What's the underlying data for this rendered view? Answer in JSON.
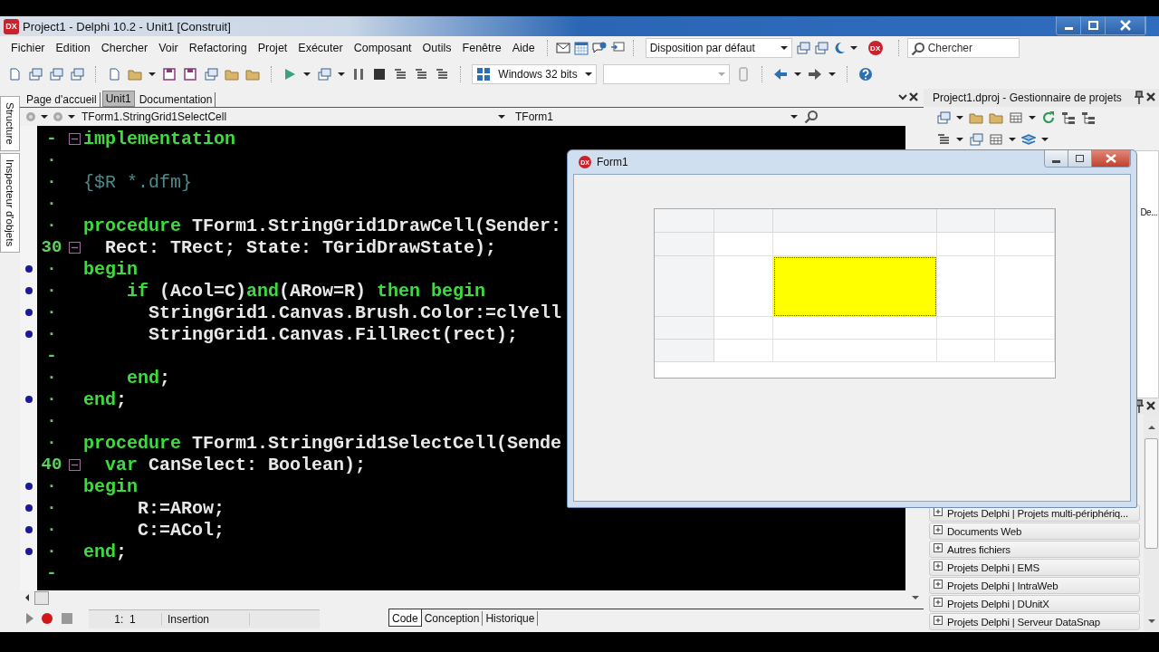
{
  "window": {
    "logo": "DX",
    "title": "Project1 - Delphi 10.2 - Unit1 [Construit]"
  },
  "menu": [
    "Fichier",
    "Edition",
    "Chercher",
    "Voir",
    "Refactoring",
    "Projet",
    "Exécuter",
    "Composant",
    "Outils",
    "Fenêtre",
    "Aide"
  ],
  "layout_combo": {
    "value": "Disposition par défaut"
  },
  "toolbar_logo": "DX",
  "search": {
    "placeholder": "Chercher"
  },
  "platform_combo": {
    "value": "Windows 32 bits"
  },
  "side_tabs": [
    "Structure",
    "Inspecteur d'objets"
  ],
  "editor_tabs": [
    {
      "label": "Page d'accueil",
      "selected": false
    },
    {
      "label": "Unit1",
      "selected": true
    },
    {
      "label": "Documentation",
      "selected": false
    }
  ],
  "method_combo": {
    "value": "TForm1.StringGrid1SelectCell"
  },
  "class_combo": {
    "value": "TForm1"
  },
  "code_lines": [
    {
      "gutter": "-",
      "breakpoint": false,
      "fold": true,
      "tokens": [
        {
          "kind": "keyword",
          "text": "implementation"
        }
      ]
    },
    {
      "gutter": "·",
      "breakpoint": false,
      "fold": false
    },
    {
      "gutter": "·",
      "breakpoint": false,
      "fold": false,
      "tokens": [
        {
          "kind": "comment",
          "text": "{$R *.dfm}"
        }
      ]
    },
    {
      "gutter": "·",
      "breakpoint": false,
      "fold": false
    },
    {
      "gutter": "·",
      "breakpoint": false,
      "fold": false,
      "tokens": [
        {
          "kind": "keyword",
          "text": "procedure"
        },
        {
          "kind": "plain",
          "text": " TForm1.StringGrid1DrawCell(Sender:"
        }
      ]
    },
    {
      "gutter": "30",
      "breakpoint": false,
      "fold": true,
      "tokens": [
        {
          "kind": "plain",
          "text": "  Rect: TRect; State: TGridDrawState);"
        }
      ]
    },
    {
      "gutter": "·",
      "breakpoint": true,
      "fold": false,
      "tokens": [
        {
          "kind": "keyword",
          "text": "begin"
        }
      ]
    },
    {
      "gutter": "·",
      "breakpoint": true,
      "fold": false,
      "tokens": [
        {
          "kind": "keyword",
          "text": "    if"
        },
        {
          "kind": "plain",
          "text": " (Acol=C)"
        },
        {
          "kind": "keyword",
          "text": "and"
        },
        {
          "kind": "plain",
          "text": "(ARow=R) "
        },
        {
          "kind": "keyword",
          "text": "then begin"
        }
      ]
    },
    {
      "gutter": "·",
      "breakpoint": true,
      "fold": false,
      "tokens": [
        {
          "kind": "plain",
          "text": "      StringGrid1.Canvas.Brush.Color:=clYell"
        }
      ]
    },
    {
      "gutter": "·",
      "breakpoint": true,
      "fold": false,
      "tokens": [
        {
          "kind": "plain",
          "text": "      StringGrid1.Canvas.FillRect(rect);"
        }
      ]
    },
    {
      "gutter": "-",
      "breakpoint": false,
      "fold": false
    },
    {
      "gutter": "·",
      "breakpoint": false,
      "fold": false,
      "tokens": [
        {
          "kind": "keyword",
          "text": "    end"
        },
        {
          "kind": "plain",
          "text": ";"
        }
      ]
    },
    {
      "gutter": "·",
      "breakpoint": true,
      "fold": false,
      "tokens": [
        {
          "kind": "keyword",
          "text": "end"
        },
        {
          "kind": "plain",
          "text": ";"
        }
      ]
    },
    {
      "gutter": "·",
      "breakpoint": false,
      "fold": false
    },
    {
      "gutter": "·",
      "breakpoint": false,
      "fold": false,
      "tokens": [
        {
          "kind": "keyword",
          "text": "procedure"
        },
        {
          "kind": "plain",
          "text": " TForm1.StringGrid1SelectCell(Sende"
        }
      ]
    },
    {
      "gutter": "40",
      "breakpoint": false,
      "fold": true,
      "tokens": [
        {
          "kind": "keyword",
          "text": "  var"
        },
        {
          "kind": "plain",
          "text": " CanSelect: Boolean);"
        }
      ]
    },
    {
      "gutter": "·",
      "breakpoint": true,
      "fold": false,
      "tokens": [
        {
          "kind": "keyword",
          "text": "begin"
        }
      ]
    },
    {
      "gutter": "·",
      "breakpoint": true,
      "fold": false,
      "tokens": [
        {
          "kind": "plain",
          "text": "     R:=ARow;"
        }
      ]
    },
    {
      "gutter": "·",
      "breakpoint": true,
      "fold": false,
      "tokens": [
        {
          "kind": "plain",
          "text": "     C:=ACol;"
        }
      ]
    },
    {
      "gutter": "·",
      "breakpoint": true,
      "fold": false,
      "tokens": [
        {
          "kind": "keyword",
          "text": "end"
        },
        {
          "kind": "plain",
          "text": ";"
        }
      ]
    },
    {
      "gutter": "-",
      "breakpoint": false,
      "fold": false
    }
  ],
  "status": {
    "position": "1:  1",
    "mode": "Insertion"
  },
  "view_tabs": [
    {
      "label": "Code",
      "selected": true
    },
    {
      "label": "Conception",
      "selected": false
    },
    {
      "label": "Historique",
      "selected": false
    }
  ],
  "form_window": {
    "logo": "DX",
    "title": "Form1",
    "grid": {
      "rows": [
        {
          "cells": [
            {
              "selected": false
            },
            {
              "selected": false
            },
            {
              "selected": false
            },
            {
              "selected": false
            },
            {
              "selected": false
            }
          ]
        },
        {
          "cells": [
            {
              "selected": false
            },
            {
              "selected": false
            },
            {
              "selected": false
            },
            {
              "selected": false
            },
            {
              "selected": false
            }
          ]
        },
        {
          "cells": [
            {
              "selected": false
            },
            {
              "selected": false
            },
            {
              "selected": true
            },
            {
              "selected": false
            },
            {
              "selected": false
            }
          ]
        },
        {
          "cells": [
            {
              "selected": false
            },
            {
              "selected": false
            },
            {
              "selected": false
            },
            {
              "selected": false
            },
            {
              "selected": false
            }
          ]
        },
        {
          "cells": [
            {
              "selected": false
            },
            {
              "selected": false
            },
            {
              "selected": false
            },
            {
              "selected": false
            },
            {
              "selected": false
            }
          ]
        }
      ]
    }
  },
  "project_manager": {
    "title": "Project1.dproj - Gestionnaire de projets",
    "tree_fragment": "De..."
  },
  "gallery_items": [
    "Projets Delphi | Projets multi-périphériq...",
    "Documents Web",
    "Autres fichiers",
    "Projets Delphi | EMS",
    "Projets Delphi | IntraWeb",
    "Projets Delphi | DUnitX",
    "Projets Delphi | Serveur DataSnap"
  ]
}
